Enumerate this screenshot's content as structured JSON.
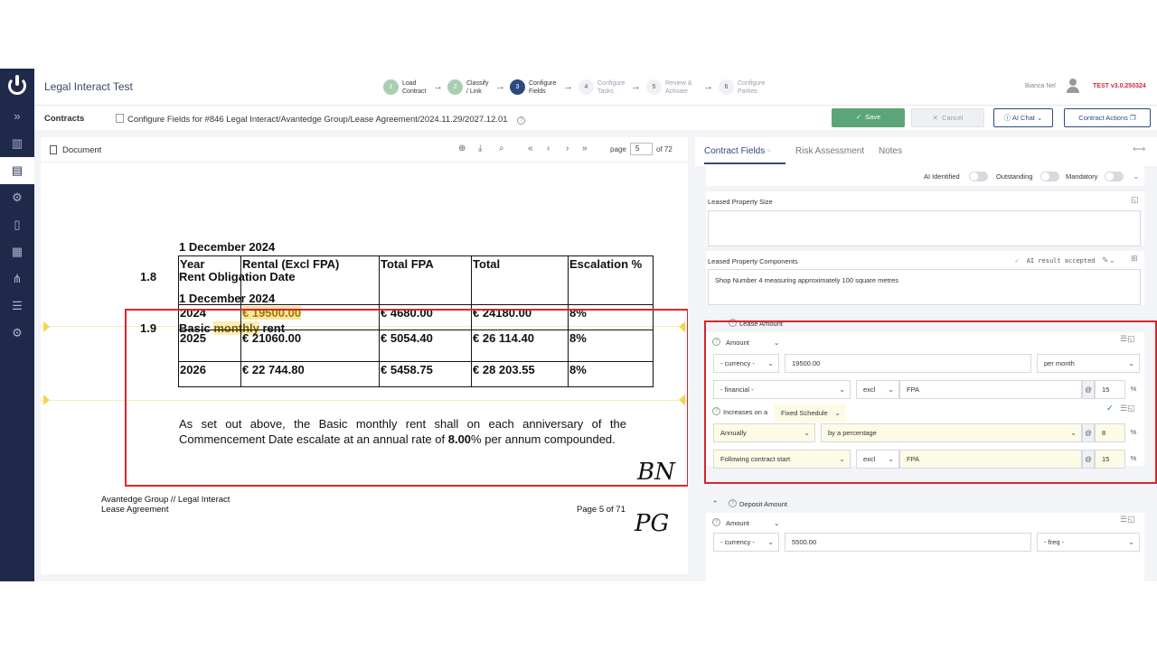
{
  "app": {
    "title": "Legal Interact Test",
    "user_name": "Bianca Nel",
    "version": "TEST v3.0.250324"
  },
  "steps": [
    {
      "num": "1",
      "line1": "Load",
      "line2": "Contract",
      "state": "done"
    },
    {
      "num": "2",
      "line1": "Classify",
      "line2": "/ Link",
      "state": "done"
    },
    {
      "num": "3",
      "line1": "Configure",
      "line2": "Fields",
      "state": "current"
    },
    {
      "num": "4",
      "line1": "Configure",
      "line2": "Tasks",
      "state": "pending"
    },
    {
      "num": "5",
      "line1": "Review &",
      "line2": "Activate",
      "state": "pending"
    },
    {
      "num": "6",
      "line1": "Configure",
      "line2": "Parties",
      "state": "pending"
    }
  ],
  "breadcrumb": {
    "section": "Contracts",
    "path": "Configure Fields for #846 Legal Interact/Avantedge Group/Lease Agreement/2024.11.29/2027.12.01"
  },
  "actions": {
    "save": "Save",
    "cancel": "Cancel",
    "ai_chat": "AI Chat",
    "contract_actions": "Contract Actions"
  },
  "document": {
    "panel_title": "Document",
    "page_label": "page",
    "page_current": "5",
    "page_total": "of 72",
    "top_date": "1 December 2024",
    "s18_num": "1.8",
    "s18_title": "Rent Obligation Date",
    "s18_value": "1 December 2024",
    "s19_num": "1.9",
    "s19_title_pre": "Basic ",
    "s19_title_hl": "monthly",
    "s19_title_post": " rent",
    "table_headers": [
      "Year",
      "Rental (Excl FPA)",
      "Total FPA",
      "Total",
      "Escalation %"
    ],
    "table_rows": [
      [
        "2024",
        "€ 19500.00",
        "€ 4680.00",
        "€ 24180.00",
        "8%"
      ],
      [
        "2025",
        "€ 21060.00",
        "€ 5054.40",
        "€ 26 114.40",
        "8%"
      ],
      [
        "2026",
        "€ 22 744.80",
        "€ 5458.75",
        "€ 28 203.55",
        "8%"
      ]
    ],
    "para_pre": "As set out above, the Basic monthly rent shall on each anniversary of the Commencement Date escalate at an annual rate of ",
    "para_bold": "8.00",
    "para_post": "% per annum compounded.",
    "footer_line1": "Avantedge Group // Legal Interact",
    "footer_line2": "Lease Agreement",
    "footer_page": "Page 5 of 71",
    "initials_1": "BN",
    "initials_2": "PG"
  },
  "fields_panel": {
    "tabs": [
      "Contract Fields",
      "Risk Assessment",
      "Notes"
    ],
    "filters": {
      "ai_identified": "AI Identified",
      "outstanding": "Outstanding",
      "mandatory": "Mandatory"
    },
    "leased_size_label": "Leased Property Size",
    "leased_components_label": "Leased Property Components",
    "leased_components_value": "Shop Number 4 measuring approximately 100 square metres",
    "ai_accepted": "AI result accepted",
    "lease_amount": {
      "title": "Lease Amount",
      "amount_label": "Amount",
      "currency_placeholder": "- currency -",
      "amount_value": "19500.00",
      "frequency": "per month",
      "financial_placeholder": "- financial -",
      "excl": "excl",
      "fpa": "FPA",
      "at": "@",
      "fpa_rate": "15",
      "pct": "%",
      "increases_on": "Increases on a",
      "schedule": "Fixed Schedule",
      "interval": "Annually",
      "method": "by a percentage",
      "rate": "8",
      "start": "Following contract start",
      "excl2": "excl",
      "fpa2": "FPA",
      "fpa_rate2": "15"
    },
    "deposit_amount": {
      "title": "Deposit Amount",
      "amount_label": "Amount",
      "currency_placeholder": "- currency -",
      "amount_value": "5500.00",
      "freq_placeholder": "- freq -"
    }
  }
}
